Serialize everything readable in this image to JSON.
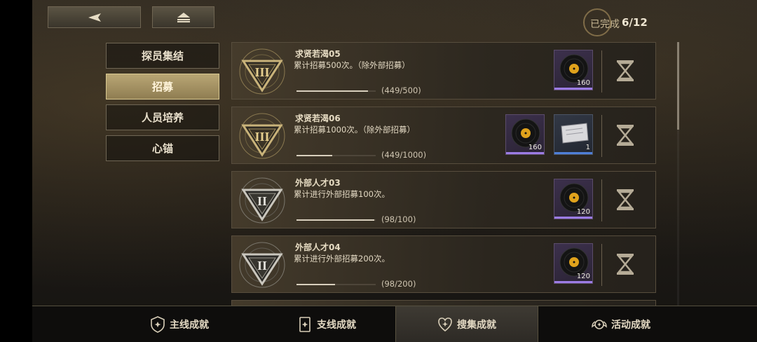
{
  "header": {
    "back_icon": "back-arrow-icon",
    "home_icon": "home-icon",
    "completed_label": "已完成",
    "completed_count": "6/12"
  },
  "side_menu": {
    "items": [
      {
        "label": "探员集结",
        "active": false
      },
      {
        "label": "招募",
        "active": true
      },
      {
        "label": "人员培养",
        "active": false
      },
      {
        "label": "心锚",
        "active": false
      }
    ]
  },
  "achievements": [
    {
      "title": "求贤若渴05",
      "desc": "累计招募500次。（除外部招募）",
      "progress_text": "(449/500)",
      "progress": 0.898,
      "emblem": "gold",
      "rewards": [
        {
          "type": "record",
          "qty": "160",
          "rarity": "purple"
        }
      ]
    },
    {
      "title": "求贤若渴06",
      "desc": "累计招募1000次。（除外部招募）",
      "progress_text": "(449/1000)",
      "progress": 0.449,
      "emblem": "gold",
      "rewards": [
        {
          "type": "record",
          "qty": "160",
          "rarity": "purple"
        },
        {
          "type": "ticket",
          "qty": "1",
          "rarity": "blue"
        }
      ]
    },
    {
      "title": "外部人才03",
      "desc": "累计进行外部招募100次。",
      "progress_text": "(98/100)",
      "progress": 0.98,
      "emblem": "silver",
      "rewards": [
        {
          "type": "record",
          "qty": "120",
          "rarity": "purple"
        }
      ]
    },
    {
      "title": "外部人才04",
      "desc": "累计进行外部招募200次。",
      "progress_text": "(98/200)",
      "progress": 0.49,
      "emblem": "silver",
      "rewards": [
        {
          "type": "record",
          "qty": "120",
          "rarity": "purple"
        }
      ]
    }
  ],
  "tabs": [
    {
      "label": "主线成就",
      "icon": "shield-icon",
      "active": false
    },
    {
      "label": "支线成就",
      "icon": "card-icon",
      "active": false
    },
    {
      "label": "搜集成就",
      "icon": "heart-badge-icon",
      "active": true
    },
    {
      "label": "活动成就",
      "icon": "winged-badge-icon",
      "active": false
    }
  ],
  "colors": {
    "accent_gold": "#b9a674",
    "rarity_purple": "#9c7ce4",
    "rarity_blue": "#4f7fd8"
  }
}
